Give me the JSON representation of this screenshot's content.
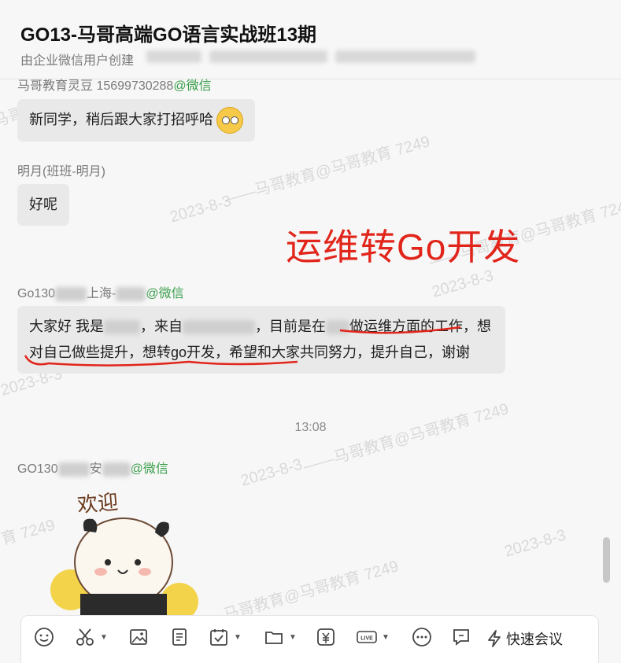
{
  "header": {
    "title": "GO13-马哥高端GO语言实战班13期",
    "subtitle": "由企业微信用户创建"
  },
  "messages": [
    {
      "sender": "马哥教育灵豆 15699730288",
      "source": "@微信",
      "text": "新同学，稍后跟大家打招呼哈"
    },
    {
      "sender": "明月(班班-明月)",
      "text": "好呢"
    },
    {
      "sender_prefix": "Go130",
      "sender_mid": "上海-",
      "source": "@微信",
      "text_parts": [
        "大家好 我是",
        "，来自",
        "，目前是在",
        "做运维方面的工作，想对自己做些提升，想转go开发，希望和大家共同努力，提升自己，谢谢"
      ]
    },
    {
      "time": "13:08"
    },
    {
      "sender_prefix": "GO130",
      "sender_mid": "安",
      "source": "@微信",
      "sticker_text": "欢迎"
    }
  ],
  "annotation": "运维转Go开发",
  "watermarks": {
    "text": "——马哥教育@马哥教育 7249",
    "date": "2023-8-3"
  },
  "toolbar": {
    "icons": [
      "emoji-icon",
      "scissors-icon",
      "image-icon",
      "document-icon",
      "calendar-check-icon",
      "folder-icon",
      "payment-icon",
      "live-icon",
      "more-chat-icon",
      "comment-icon"
    ],
    "quick_meeting_label": "快速会议"
  }
}
